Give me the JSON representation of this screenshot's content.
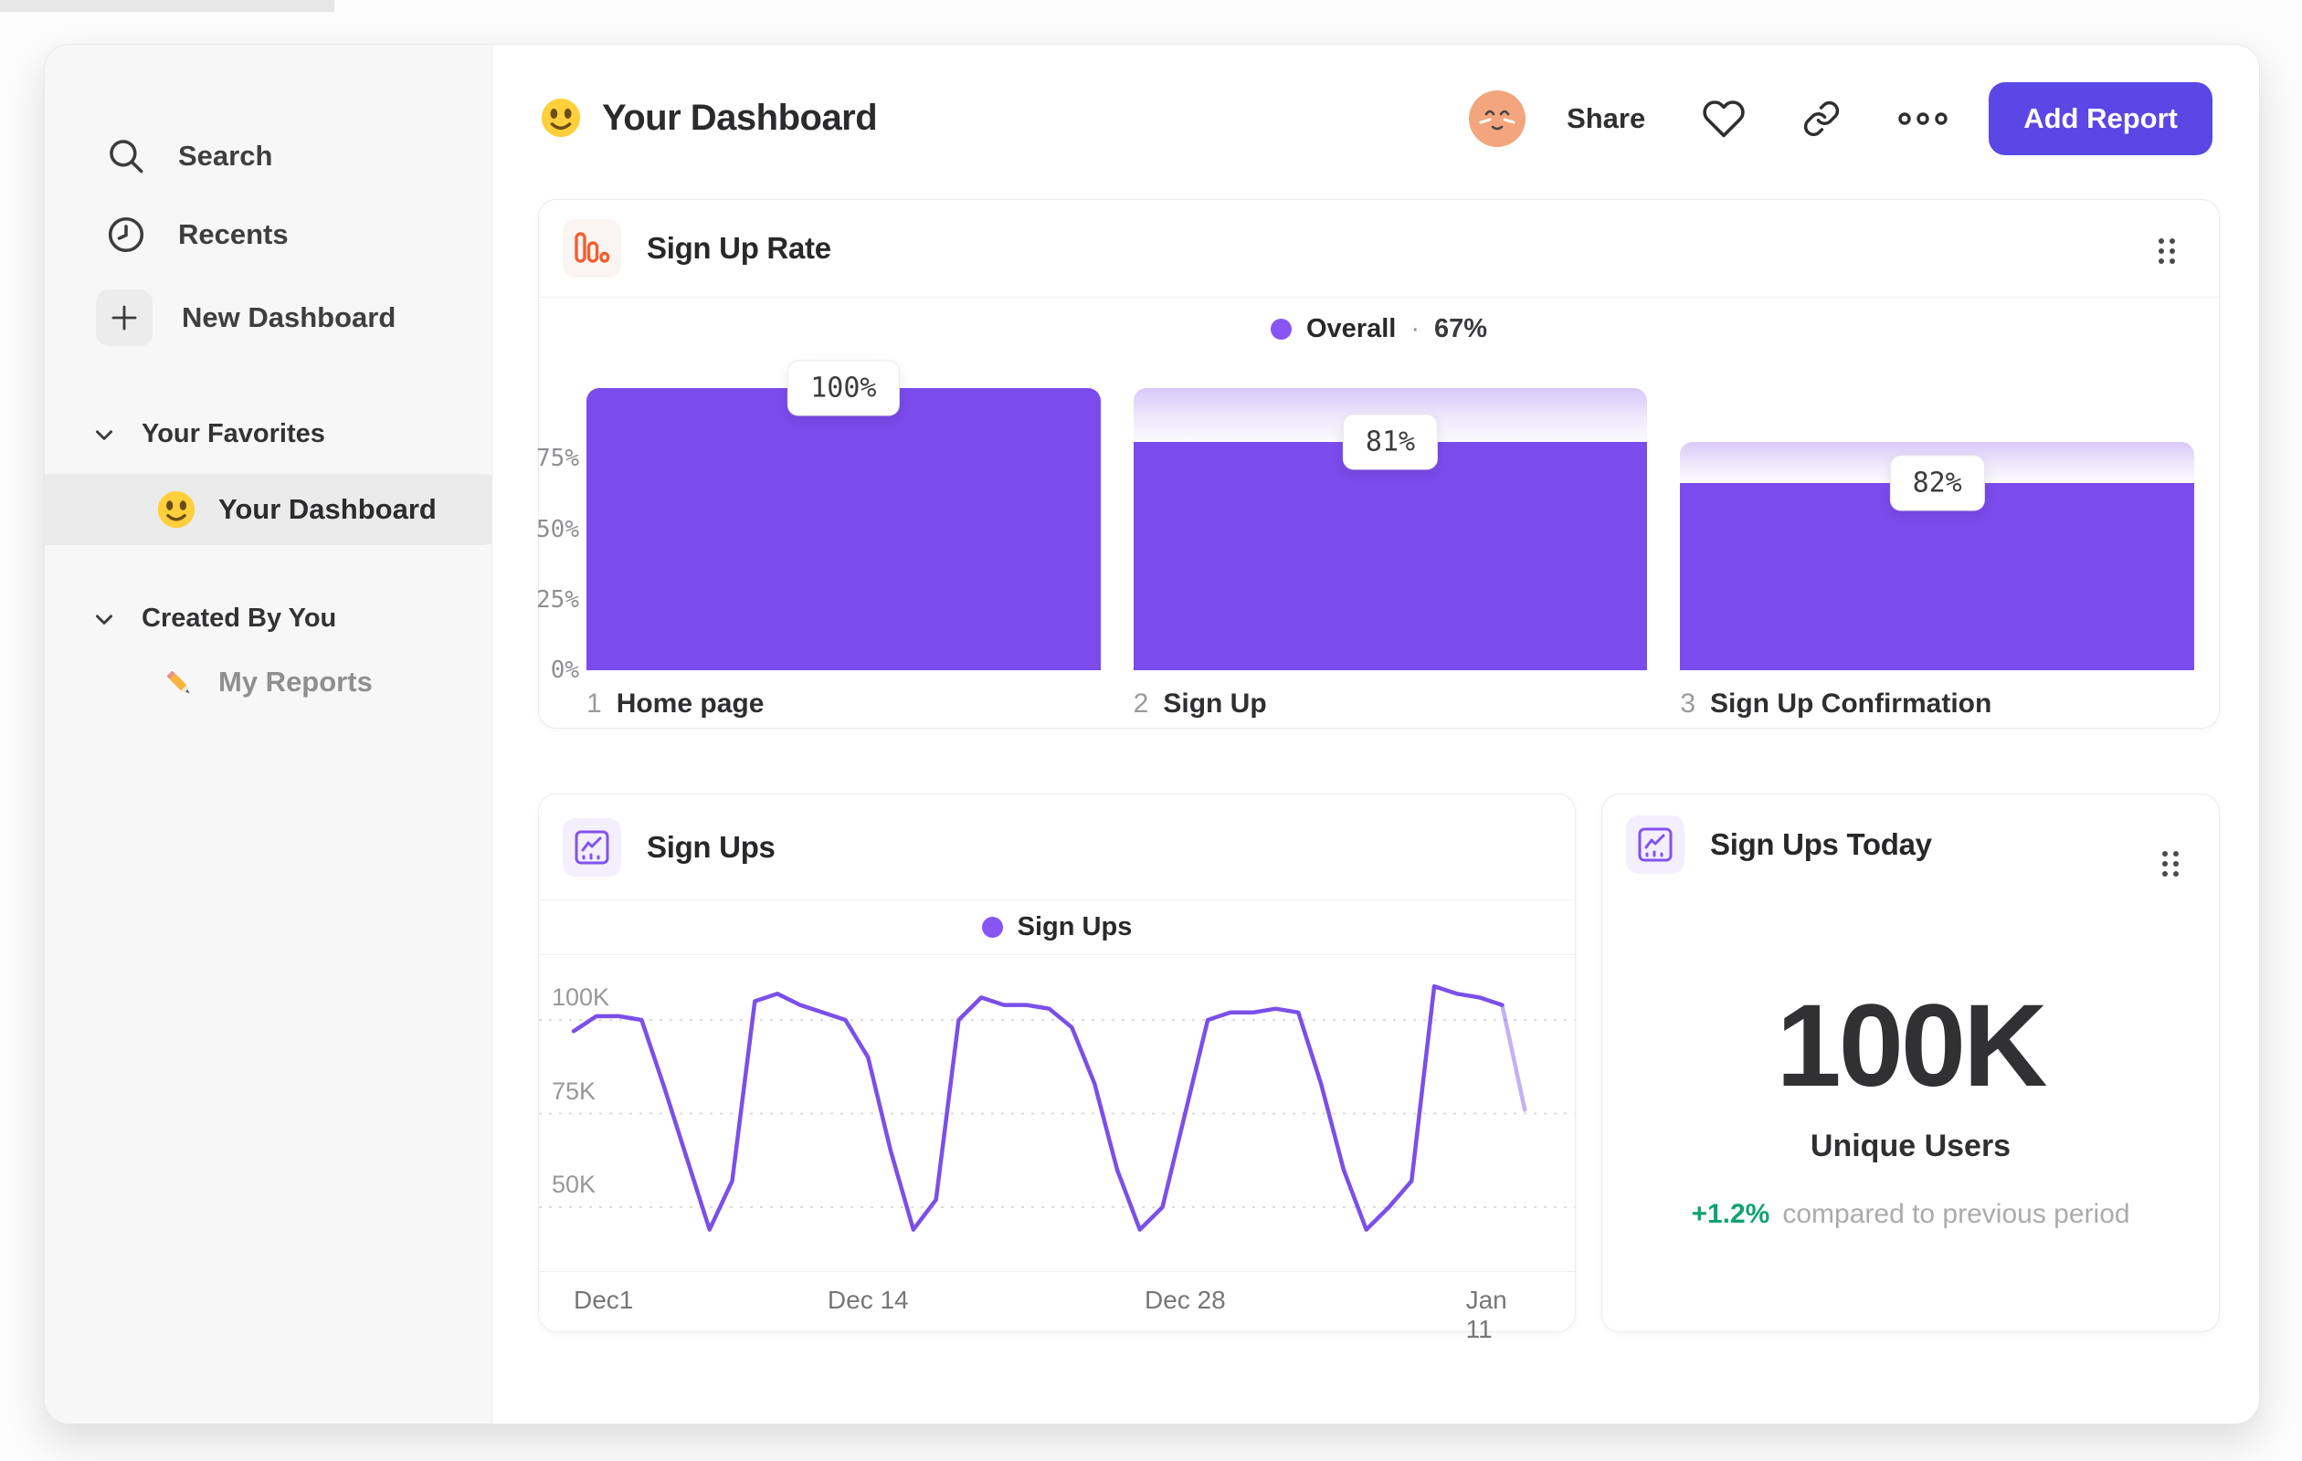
{
  "sidebar": {
    "search_label": "Search",
    "recents_label": "Recents",
    "new_dashboard_label": "New Dashboard",
    "favorites_header": "Your Favorites",
    "favorite_item": "Your Dashboard",
    "created_header": "Created By You",
    "created_item": "My Reports"
  },
  "header": {
    "title": "Your Dashboard",
    "share_label": "Share",
    "add_report_label": "Add Report"
  },
  "cards": {
    "funnel": {
      "title": "Sign Up Rate",
      "legend_name": "Overall",
      "legend_sep": "·",
      "legend_value": "67%"
    },
    "line": {
      "title": "Sign Ups",
      "legend_name": "Sign Ups"
    },
    "metric": {
      "title": "Sign Ups Today",
      "value": "100K",
      "label": "Unique Users",
      "delta": "+1.2%",
      "note": "compared to previous period"
    }
  },
  "colors": {
    "accent_purple": "#7c4bec",
    "line_purple": "#7b4fe9",
    "legend_dot": "#8655f3",
    "button_purple": "#5a47e6",
    "icon_orange": "#f25e33",
    "icon_purple": "#8152f0",
    "delta_green": "#11a36e",
    "avatar_peach": "#f3a67e"
  },
  "chart_data": [
    {
      "id": "sign-up-rate-funnel",
      "type": "bar",
      "title": "Sign Up Rate",
      "legend": "Overall",
      "overall_conversion": "67%",
      "categories": [
        "Home page",
        "Sign Up",
        "Sign Up Confirmation"
      ],
      "step_numbers": [
        "1",
        "2",
        "3"
      ],
      "bar_labels": [
        "100%",
        "81%",
        "82%"
      ],
      "step_conversion_pct": [
        100,
        81,
        82
      ],
      "cumulative_pct": [
        100,
        81,
        66.4
      ],
      "previous_cumulative_pct": [
        100,
        100,
        81
      ],
      "y_ticks": [
        {
          "label": "75%",
          "value": 75
        },
        {
          "label": "50%",
          "value": 50
        },
        {
          "label": "25%",
          "value": 25
        },
        {
          "label": "0%",
          "value": 0
        }
      ],
      "ylim": [
        0,
        100
      ],
      "grid": false,
      "legend_position": "top-center"
    },
    {
      "id": "sign-ups-line",
      "type": "line",
      "title": "Sign Ups",
      "legend": "Sign Ups",
      "x_unit": "days since Dec 1",
      "x_days": [
        0,
        1,
        2,
        3,
        4,
        5,
        6,
        7,
        8,
        9,
        10,
        11,
        12,
        13,
        14,
        15,
        16,
        17,
        18,
        19,
        20,
        21,
        22,
        23,
        24,
        25,
        26,
        27,
        28,
        29,
        30,
        31,
        32,
        33,
        34,
        35,
        36,
        37,
        38,
        39,
        40,
        41,
        42
      ],
      "values_k": [
        97,
        101,
        101,
        100,
        82,
        63,
        44,
        57,
        105,
        107,
        104,
        102,
        100,
        90,
        65,
        44,
        52,
        100,
        106,
        104,
        104,
        103,
        98,
        83,
        60,
        44,
        50,
        75,
        100,
        102,
        102,
        103,
        102,
        83,
        60,
        44,
        50,
        57,
        109,
        107,
        106,
        104,
        76
      ],
      "faded_from_index": 41,
      "x_ticks": [
        {
          "day": 0,
          "label": "Dec1"
        },
        {
          "day": 13,
          "label": "Dec 14"
        },
        {
          "day": 27,
          "label": "Dec 28"
        },
        {
          "day": 41,
          "label": "Jan 11"
        }
      ],
      "y_ticks": [
        {
          "label": "100K",
          "value": 100
        },
        {
          "label": "75K",
          "value": 75
        },
        {
          "label": "50K",
          "value": 50
        }
      ],
      "ylim_k": [
        40,
        112
      ],
      "x_domain_days": [
        0,
        43
      ],
      "grid": "dashed-horizontal",
      "legend_position": "top-center"
    }
  ]
}
